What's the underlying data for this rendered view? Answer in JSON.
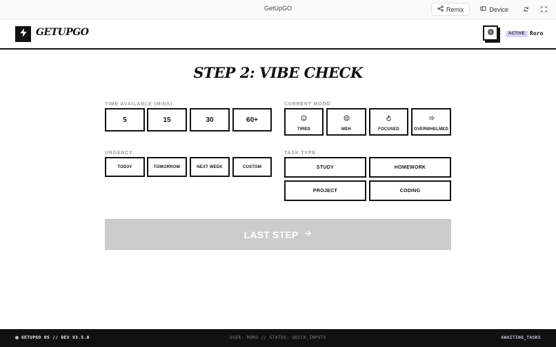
{
  "window": {
    "title": "GetUpGO",
    "remix_label": "Remix",
    "device_label": "Device",
    "icons": [
      "remix-icon",
      "device-icon",
      "refresh-icon",
      "fullscreen-icon"
    ]
  },
  "header": {
    "brand": "GETUPGO",
    "status_badge": "ACTIVE",
    "user": "Roro",
    "icons": [
      "bolt-icon",
      "gear-icon"
    ]
  },
  "main": {
    "title": "STEP 2: VIBE CHECK",
    "time": {
      "label": "TIME AVAILABLE (MINS)",
      "options": [
        "5",
        "15",
        "30",
        "60+"
      ]
    },
    "mood": {
      "label": "CURRENT MOOD",
      "options": [
        {
          "label": "TIRED",
          "icon": "tired-face-icon"
        },
        {
          "label": "MEH",
          "icon": "meh-face-icon"
        },
        {
          "label": "FOCUSED",
          "icon": "flame-icon"
        },
        {
          "label": "OVERWHELMED",
          "icon": "overwhelmed-arrow-icon"
        }
      ]
    },
    "urgency": {
      "label": "URGENCY",
      "options": [
        "TODAY",
        "TOMORROW",
        "NEXT WEEK",
        "CUSTOM"
      ]
    },
    "task_type": {
      "label": "TASK TYPE",
      "options": [
        "STUDY",
        "HOMEWORK",
        "PROJECT",
        "CODING"
      ]
    },
    "next_button": "LAST STEP",
    "next_icon": "arrow-right-icon",
    "colors": {
      "accent": "#d9d3f7",
      "disabled_button": "#cccccc",
      "ink": "#111111"
    }
  },
  "footer": {
    "left": "GETUPGO OS // DEV V3.5.0",
    "center": "USER: RORO // STATUS: QUICK_INPUTS",
    "right": "AWAITING_TASKS"
  }
}
